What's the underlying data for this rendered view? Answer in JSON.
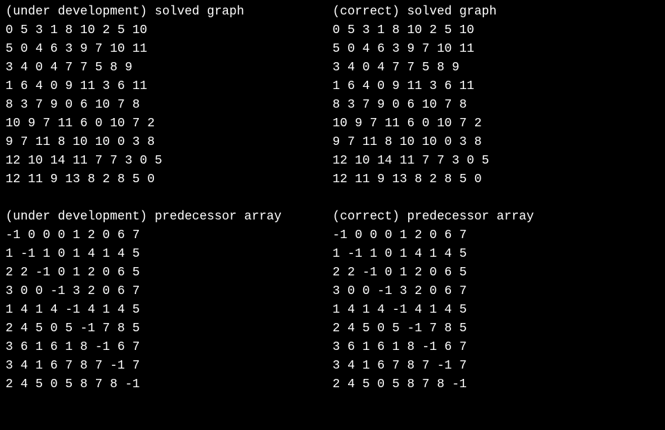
{
  "left": {
    "solved_graph": {
      "header": "(under development) solved graph",
      "rows": [
        "0 5 3 1 8 10 2 5 10",
        "5 0 4 6 3 9 7 10 11",
        "3 4 0 4 7 7 5 8 9",
        "1 6 4 0 9 11 3 6 11",
        "8 3 7 9 0 6 10 7 8",
        "10 9 7 11 6 0 10 7 2",
        "9 7 11 8 10 10 0 3 8",
        "12 10 14 11 7 7 3 0 5",
        "12 11 9 13 8 2 8 5 0"
      ]
    },
    "predecessor_array": {
      "header": "(under development) predecessor array",
      "rows": [
        "-1 0 0 0 1 2 0 6 7",
        "1 -1 1 0 1 4 1 4 5",
        "2 2 -1 0 1 2 0 6 5",
        "3 0 0 -1 3 2 0 6 7",
        "1 4 1 4 -1 4 1 4 5",
        "2 4 5 0 5 -1 7 8 5",
        "3 6 1 6 1 8 -1 6 7",
        "3 4 1 6 7 8 7 -1 7",
        "2 4 5 0 5 8 7 8 -1"
      ]
    }
  },
  "right": {
    "solved_graph": {
      "header": "(correct) solved graph",
      "rows": [
        "0 5 3 1 8 10 2 5 10",
        "5 0 4 6 3 9 7 10 11",
        "3 4 0 4 7 7 5 8 9",
        "1 6 4 0 9 11 3 6 11",
        "8 3 7 9 0 6 10 7 8",
        "10 9 7 11 6 0 10 7 2",
        "9 7 11 8 10 10 0 3 8",
        "12 10 14 11 7 7 3 0 5",
        "12 11 9 13 8 2 8 5 0"
      ]
    },
    "predecessor_array": {
      "header": "(correct) predecessor array",
      "rows": [
        "-1 0 0 0 1 2 0 6 7",
        "1 -1 1 0 1 4 1 4 5",
        "2 2 -1 0 1 2 0 6 5",
        "3 0 0 -1 3 2 0 6 7",
        "1 4 1 4 -1 4 1 4 5",
        "2 4 5 0 5 -1 7 8 5",
        "3 6 1 6 1 8 -1 6 7",
        "3 4 1 6 7 8 7 -1 7",
        "2 4 5 0 5 8 7 8 -1"
      ]
    }
  }
}
